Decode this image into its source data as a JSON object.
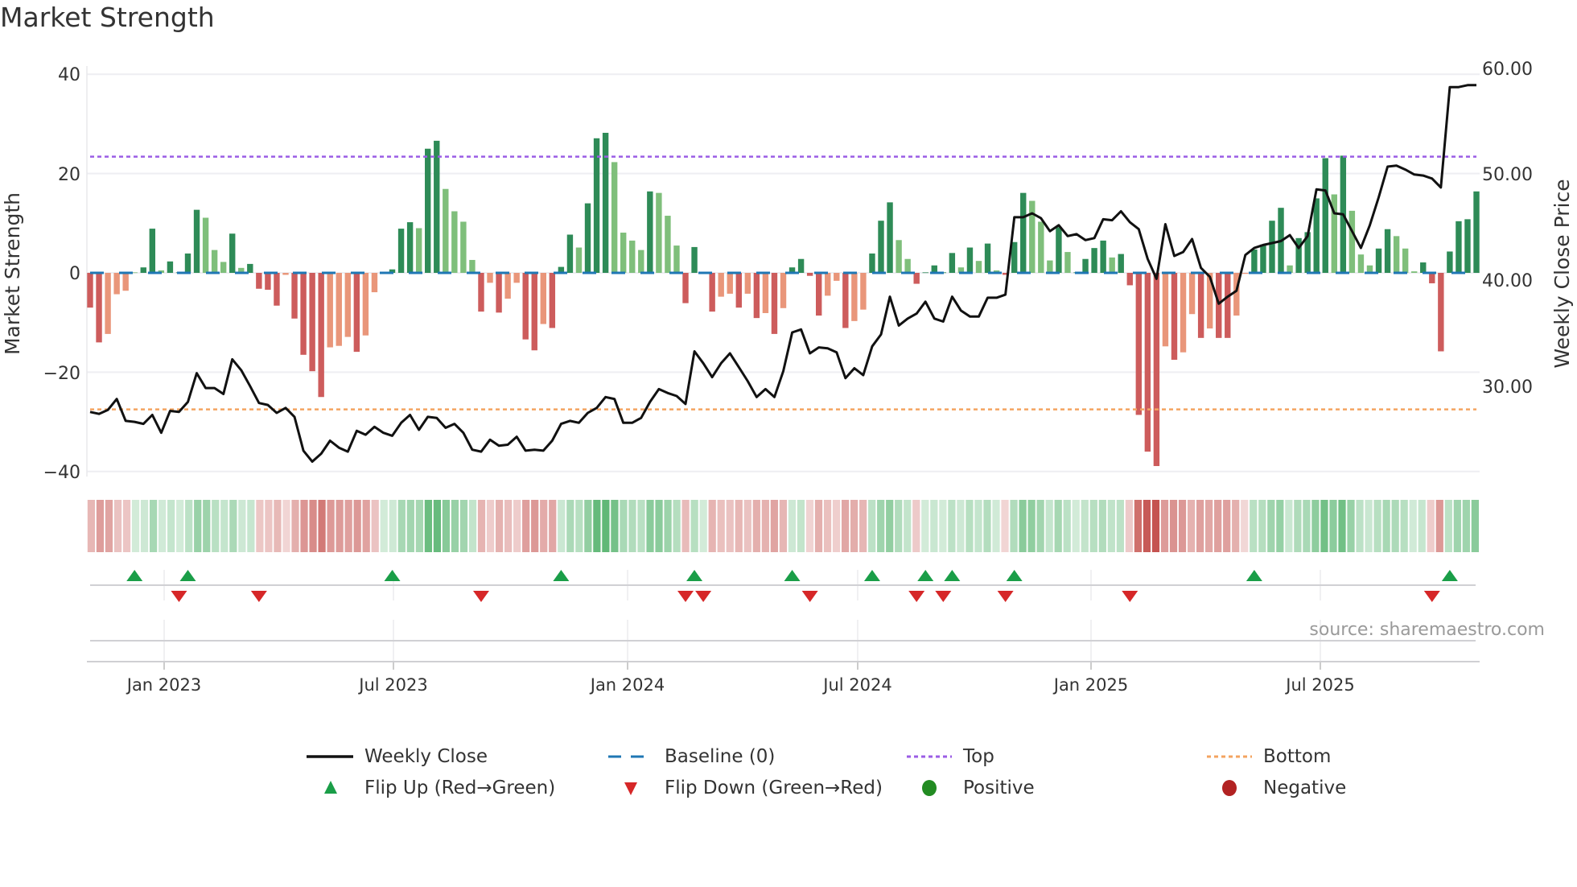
{
  "chart_data": {
    "type": "bar",
    "title": "Market Strength",
    "ylabel": "Market Strength",
    "y2label": "Weekly Close Price",
    "ylim": [
      -40,
      40
    ],
    "y2lim": [
      20,
      60
    ],
    "yticks": [
      "40",
      "20",
      "0",
      "−20",
      "−40"
    ],
    "y2ticks": [
      "60.00",
      "50.00",
      "40.00",
      "30.00"
    ],
    "xticks": [
      "Jan 2023",
      "Jul 2023",
      "Jan 2024",
      "Jul 2024",
      "Jan 2025",
      "Jul 2025"
    ],
    "x_start": "2022-11-04",
    "x_step": "weekly",
    "top_level": 23.4,
    "bottom_level": -27.5,
    "baseline": 0,
    "strength": [
      -7.0,
      -14,
      -12.3,
      -4.3,
      -3.6,
      0.1,
      1.1,
      8.9,
      0.5,
      2.3,
      0.1,
      3.9,
      12.7,
      11.1,
      4.6,
      2.2,
      7.9,
      1.0,
      1.8,
      -3.2,
      -3.4,
      -6.6,
      -0.4,
      -9.2,
      -16.5,
      -19.8,
      -25,
      -15,
      -14.7,
      -12.9,
      -15.9,
      -12.6,
      -3.9,
      0.1,
      0.7,
      8.9,
      10.2,
      9.0,
      25,
      26.6,
      16.9,
      12.4,
      10.3,
      2.6,
      -7.8,
      -2.0,
      -8.0,
      -5.2,
      -2.0,
      -13.4,
      -15.6,
      -10.3,
      -11.1,
      1.2,
      7.7,
      5.1,
      14,
      27.1,
      28.2,
      22.3,
      8.1,
      6.5,
      4.6,
      16.4,
      16.1,
      11.5,
      5.5,
      -6.1,
      5.2,
      0.1,
      -7.8,
      -4.8,
      -4.2,
      -7.0,
      -4.2,
      -9.1,
      -8.1,
      -12.3,
      -7.1,
      1.1,
      2.8,
      -0.6,
      -8.6,
      -4.6,
      -1.6,
      -11.1,
      -9.7,
      -7.4,
      3.9,
      10.5,
      14.2,
      6.6,
      2.8,
      -2.2,
      0.1,
      1.5,
      0.1,
      4.0,
      1.1,
      5.1,
      2.4,
      5.9,
      0.5,
      -0.4,
      6.2,
      16.1,
      14.5,
      10.3,
      2.5,
      9.2,
      4.2,
      0.1,
      2.8,
      5.0,
      6.5,
      3.1,
      3.8,
      -2.5,
      -28.6,
      -36,
      -38.9,
      -14.8,
      -17.5,
      -16,
      -8.3,
      -13.1,
      -11.2,
      -13.1,
      -13.1,
      -8.6,
      -0.2,
      4.7,
      5.7,
      10.5,
      13.1,
      1.5,
      7.0,
      8.2,
      15.0,
      23.1,
      15.8,
      23.6,
      12.5,
      3.7,
      1.5,
      4.9,
      8.8,
      7.4,
      4.9,
      0.3,
      2.1,
      -2.1,
      -15.8,
      4.3,
      10.4,
      10.8,
      16.4
    ],
    "bar_style": "RRrrrgGGgGGGGgggGgGRRRrRRRRrrrRrrGGGGgGGggggRrRrrRRrRGGgGGGggggGgggRGGRrrRrRrRrGGRRrrRrrGGGggRGGGGgGgGgRGGgggGgGGGGgGRRRRrRrrRrRRrrGGGGgGGGGgGgggGGgggGRRGGGG",
    "bar_style_key": {
      "G": "positive-rising",
      "g": "positive-falling",
      "R": "negative-falling",
      "r": "negative-rising"
    },
    "price": [
      26.0,
      25.8,
      26.2,
      27.3,
      25.1,
      25.0,
      24.8,
      25.7,
      23.9,
      26.1,
      26.0,
      27.0,
      29.9,
      28.4,
      28.4,
      27.8,
      31.3,
      30.2,
      28.6,
      26.9,
      26.7,
      25.9,
      26.4,
      25.5,
      22.1,
      21.0,
      21.8,
      23.1,
      22.4,
      22.0,
      24.1,
      23.7,
      24.5,
      23.9,
      23.6,
      24.9,
      25.7,
      24.2,
      25.5,
      25.4,
      24.4,
      24.8,
      23.9,
      22.2,
      22.0,
      23.2,
      22.6,
      22.7,
      23.5,
      22.1,
      22.2,
      22.1,
      23.1,
      24.8,
      25.1,
      24.9,
      25.9,
      26.4,
      27.5,
      27.3,
      24.9,
      24.9,
      25.4,
      27.0,
      28.3,
      27.9,
      27.6,
      26.8,
      32.1,
      30.9,
      29.5,
      30.9,
      31.9,
      30.5,
      29.1,
      27.5,
      28.3,
      27.5,
      30.1,
      34.0,
      34.3,
      31.9,
      32.5,
      32.4,
      32.0,
      29.4,
      30.4,
      29.7,
      32.6,
      33.8,
      37.6,
      34.7,
      35.4,
      35.9,
      37.1,
      35.4,
      35.1,
      37.6,
      36.2,
      35.6,
      35.6,
      37.5,
      37.5,
      37.8,
      45.6,
      45.6,
      46.0,
      45.5,
      44.2,
      44.8,
      43.7,
      43.9,
      43.3,
      43.5,
      45.4,
      45.3,
      46.2,
      45.1,
      44.4,
      41.4,
      39.4,
      44.9,
      41.7,
      42.1,
      43.4,
      40.5,
      39.6,
      36.9,
      37.6,
      38.2,
      41.8,
      42.5,
      42.8,
      43.0,
      43.2,
      43.8,
      42.5,
      43.7,
      48.4,
      48.3,
      46.0,
      45.9,
      44.2,
      42.5,
      44.8,
      47.6,
      50.7,
      50.8,
      50.4,
      49.9,
      49.8,
      49.5,
      48.6,
      58.7,
      58.7,
      58.9,
      58.9
    ],
    "flip_up_weeks": [
      6,
      12,
      35,
      54,
      69,
      80,
      89,
      95,
      98,
      105,
      132,
      154
    ],
    "flip_down_weeks": [
      11,
      20,
      45,
      68,
      70,
      82,
      94,
      97,
      104,
      118,
      152
    ],
    "legend": {
      "weekly_close": "Weekly Close",
      "baseline": "Baseline (0)",
      "top": "Top",
      "bottom": "Bottom",
      "flip_up": "Flip Up (Red→Green)",
      "flip_down": "Flip Down (Green→Red)",
      "positive": "Positive",
      "negative": "Negative"
    },
    "legend_placement": "bottom",
    "source": "source: sharemaestro.com",
    "colors": {
      "G": "#2e8b57",
      "g": "#7fbf7b",
      "R": "#cd5c5c",
      "r": "#e9967a",
      "line": "#111111",
      "baseline": "#1f77b4",
      "top": "#9b5de5",
      "bottom": "#f4a460",
      "flip_up": "#1a9e48",
      "flip_down": "#d62728",
      "positive": "#228b22",
      "negative": "#b22222"
    }
  }
}
